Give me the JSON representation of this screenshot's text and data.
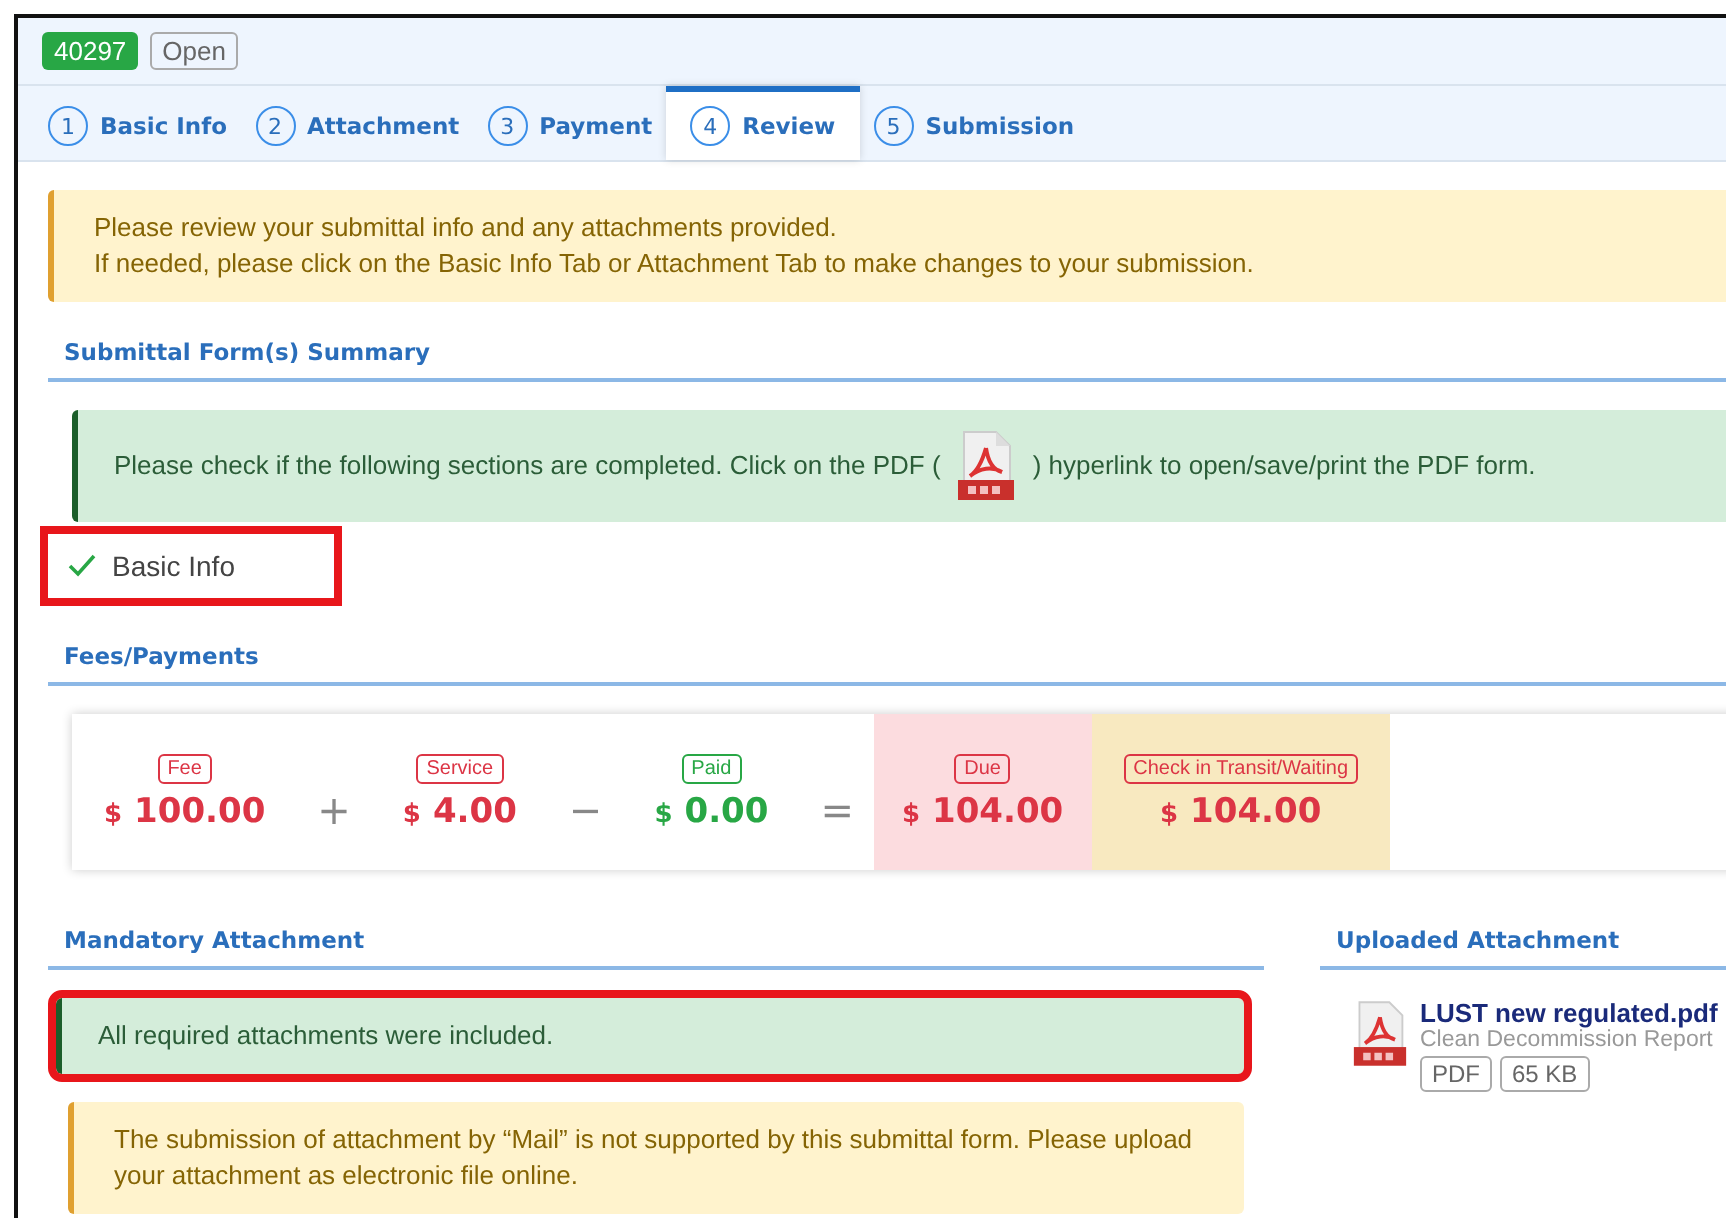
{
  "header": {
    "id_badge": "40297",
    "status_badge": "Open"
  },
  "tabs": [
    {
      "number": "1",
      "label": "Basic Info",
      "selected": false
    },
    {
      "number": "2",
      "label": "Attachment",
      "selected": false
    },
    {
      "number": "3",
      "label": "Payment",
      "selected": false
    },
    {
      "number": "4",
      "label": "Review",
      "selected": true
    },
    {
      "number": "5",
      "label": "Submission",
      "selected": false
    }
  ],
  "review_notice": [
    "Please review your submittal info and any attachments provided.",
    "If needed, please click on the Basic Info Tab or Attachment Tab to make changes to your submission."
  ],
  "summary": {
    "title": "Submittal Form(s) Summary",
    "notice_before": "Please check if the following sections are completed. Click on the PDF (",
    "notice_after": ") hyperlink to open/save/print the PDF form.",
    "sections": [
      {
        "label": "Basic Info",
        "completed": true,
        "highlighted": true
      }
    ]
  },
  "fees": {
    "title": "Fees/Payments",
    "items": [
      {
        "kind": "plain",
        "label": "Fee",
        "currency": "$",
        "amount": "100.00",
        "color": "#dc3545"
      },
      {
        "kind": "operator",
        "symbol": "+"
      },
      {
        "kind": "plain",
        "label": "Service",
        "currency": "$",
        "amount": "4.00",
        "color": "#dc3545"
      },
      {
        "kind": "operator",
        "symbol": "−"
      },
      {
        "kind": "plain",
        "label": "Paid",
        "currency": "$",
        "amount": "0.00",
        "color": "#28a745"
      },
      {
        "kind": "operator",
        "symbol": "="
      },
      {
        "kind": "due",
        "label": "Due",
        "currency": "$",
        "amount": "104.00",
        "color": "#dc3545"
      },
      {
        "kind": "transit",
        "label": "Check in Transit/Waiting",
        "currency": "$",
        "amount": "104.00",
        "color": "#dc3545"
      }
    ]
  },
  "mandatory": {
    "title": "Mandatory Attachment",
    "status": "All required attachments were included.",
    "status_highlighted": true,
    "warning": "The submission of attachment by “Mail” is not supported by this submittal form. Please upload your attachment as electronic file online."
  },
  "uploaded": {
    "title": "Uploaded Attachment",
    "files": [
      {
        "name": "LUST new regulated.pdf",
        "description": "Clean Decommission Report",
        "tags": [
          "PDF",
          "65 KB"
        ]
      }
    ]
  }
}
